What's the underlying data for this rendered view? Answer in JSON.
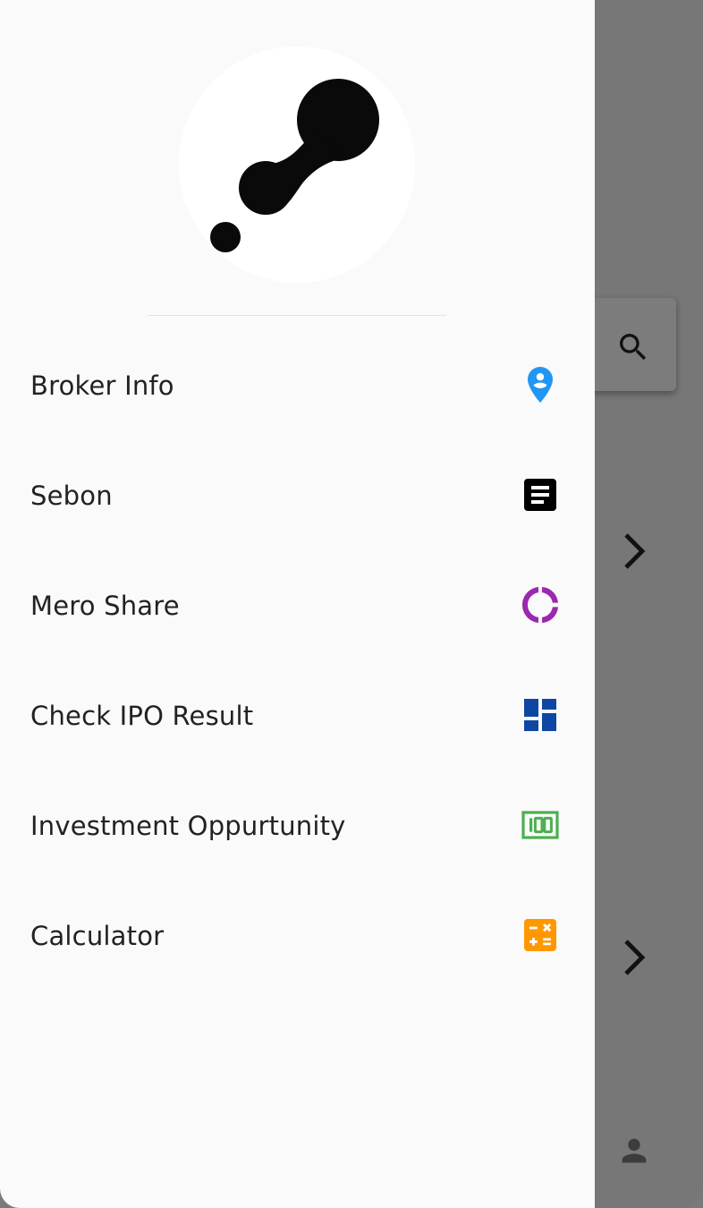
{
  "drawer": {
    "items": [
      {
        "label": "Broker Info",
        "icon": "location-person-icon",
        "color": "#2196f3"
      },
      {
        "label": "Sebon",
        "icon": "article-icon",
        "color": "#000000"
      },
      {
        "label": "Mero Share",
        "icon": "donut-icon",
        "color": "#9c27b0"
      },
      {
        "label": "Check IPO Result",
        "icon": "dashboard-icon",
        "color": "#0d47a1"
      },
      {
        "label": "Investment Oppurtunity",
        "icon": "money-100-icon",
        "color": "#4caf50"
      },
      {
        "label": "Calculator",
        "icon": "calculator-icon",
        "color": "#ff9800"
      }
    ]
  },
  "background": {
    "icons": [
      "search-icon",
      "chevron-right-icon",
      "chevron-right-icon",
      "person-icon"
    ]
  }
}
